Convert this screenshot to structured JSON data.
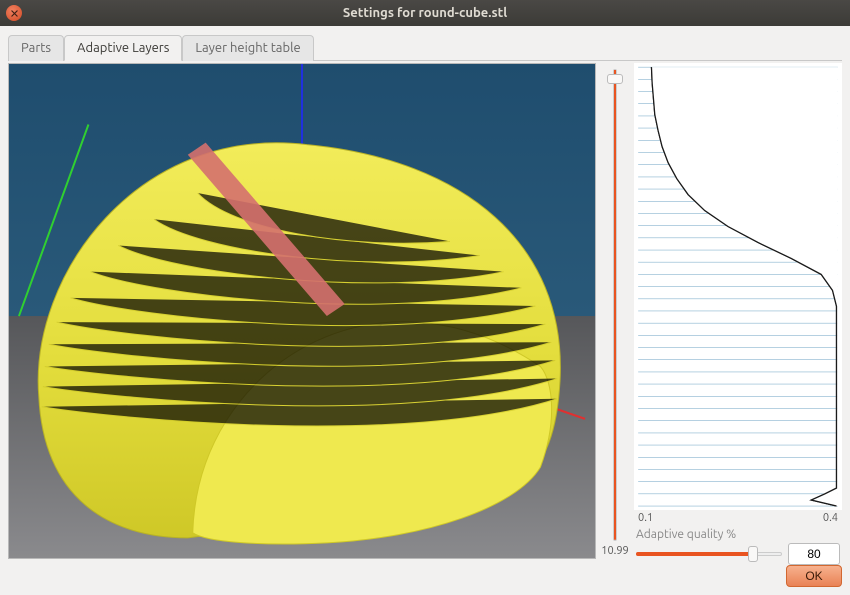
{
  "window": {
    "title": "Settings for round-cube.stl",
    "close_icon": "close"
  },
  "tabs": [
    {
      "label": "Parts",
      "active": false
    },
    {
      "label": "Adaptive Layers",
      "active": true
    },
    {
      "label": "Layer height table",
      "active": false
    }
  ],
  "vertical_slider": {
    "min": 0,
    "max": 100,
    "value": 100,
    "display": "10.99"
  },
  "chart_data": {
    "type": "line",
    "title": "",
    "xlabel": "",
    "ylabel": "",
    "xlim": [
      0.1,
      0.4
    ],
    "ylim": [
      0,
      10.99
    ],
    "x_ticks": [
      "0.1",
      "0.4"
    ],
    "series": [
      {
        "name": "layer-height-profile",
        "x": [
          0.12,
          0.121,
          0.123,
          0.125,
          0.13,
          0.136,
          0.145,
          0.158,
          0.175,
          0.2,
          0.235,
          0.28,
          0.33,
          0.375,
          0.392,
          0.398,
          0.398,
          0.398,
          0.398,
          0.398,
          0.398,
          0.398,
          0.398,
          0.398,
          0.398,
          0.398,
          0.398,
          0.398,
          0.38,
          0.36,
          0.398
        ],
        "y": [
          10.99,
          10.6,
          10.2,
          9.8,
          9.4,
          9.0,
          8.6,
          8.2,
          7.8,
          7.4,
          7.0,
          6.6,
          6.2,
          5.8,
          5.4,
          5.0,
          4.6,
          4.2,
          3.8,
          3.4,
          3.0,
          2.6,
          2.2,
          1.8,
          1.4,
          1.0,
          0.7,
          0.45,
          0.3,
          0.15,
          0.0
        ]
      }
    ],
    "horizontal_layers": {
      "count": 36,
      "color": "#2a7aa8"
    }
  },
  "quality": {
    "label": "Adaptive quality %",
    "min": 0,
    "max": 100,
    "value": 80
  },
  "footer": {
    "ok_label": "OK"
  },
  "viewport": {
    "model_color": "#e8e03a",
    "highlight_color": "#d4706e",
    "axes": {
      "x": "#e03030",
      "y": "#30d030",
      "z": "#2030e0"
    }
  }
}
